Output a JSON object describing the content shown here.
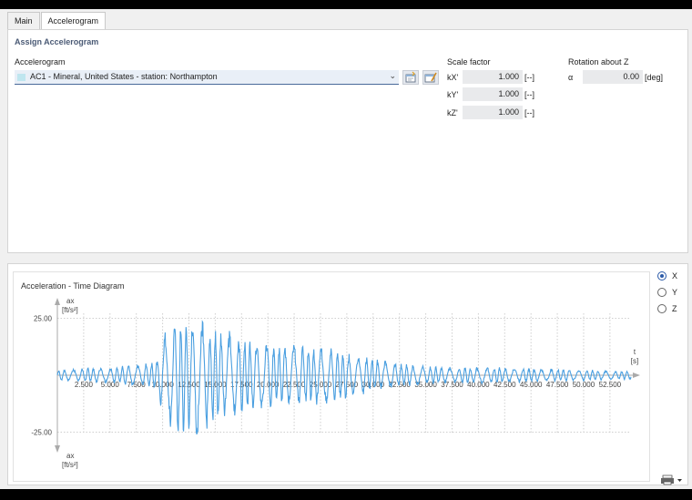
{
  "tabs": [
    {
      "label": "Main",
      "active": false
    },
    {
      "label": "Accelerogram",
      "active": true
    }
  ],
  "assign": {
    "section_title": "Assign Accelerogram",
    "accelerogram_label": "Accelerogram",
    "accelerogram_value": "AC1 - Mineral, United States - station: Northampton",
    "new_icon": "new-accelerogram-icon",
    "edit_icon": "edit-accelerogram-icon"
  },
  "scale": {
    "title": "Scale factor",
    "rows": [
      {
        "label": "kX'",
        "value": "1.000",
        "unit": "[--]"
      },
      {
        "label": "kY'",
        "value": "1.000",
        "unit": "[--]"
      },
      {
        "label": "kZ'",
        "value": "1.000",
        "unit": "[--]"
      }
    ]
  },
  "rotation": {
    "title": "Rotation about Z",
    "label": "α",
    "value": "0.00",
    "unit": "[deg]"
  },
  "diagram": {
    "title": "Acceleration - Time Diagram",
    "radios": [
      {
        "label": "X",
        "selected": true
      },
      {
        "label": "Y",
        "selected": false
      },
      {
        "label": "Z",
        "selected": false
      }
    ],
    "print_icon": "print-icon"
  },
  "chart_data": {
    "type": "line",
    "ylabel_top": "ax",
    "yunit_top": "[ft/s²]",
    "ylabel_bottom": "ax",
    "yunit_bottom": "[ft/s²]",
    "xlabel": "t",
    "xunit": "[s]",
    "xlim": [
      0,
      54.5
    ],
    "ylim": [
      -25,
      25
    ],
    "x_ticks": [
      "2.500",
      "5.000",
      "7.500",
      "10.000",
      "12.500",
      "15.000",
      "17.500",
      "20.000",
      "22.500",
      "25.000",
      "27.500",
      "30.000",
      "32.500",
      "35.000",
      "37.500",
      "40.000",
      "42.500",
      "45.000",
      "47.500",
      "50.000",
      "52.500"
    ],
    "y_ticks": [
      "25.00",
      "-25.00"
    ],
    "series": [
      {
        "color": "#4a9fe0",
        "envelope_t": [
          0,
          5,
          8,
          9.5,
          10,
          11,
          12.5,
          13.5,
          14.5,
          16,
          17.5,
          19,
          20.5,
          23,
          25,
          27,
          30,
          33,
          36,
          40,
          45,
          50,
          54
        ],
        "envelope_a": [
          2,
          3,
          4,
          6,
          14,
          20,
          22,
          23,
          18,
          16,
          15,
          13,
          12,
          11,
          11,
          9,
          6,
          4,
          3,
          3,
          2.5,
          2,
          1.5
        ]
      }
    ],
    "grid": true
  }
}
